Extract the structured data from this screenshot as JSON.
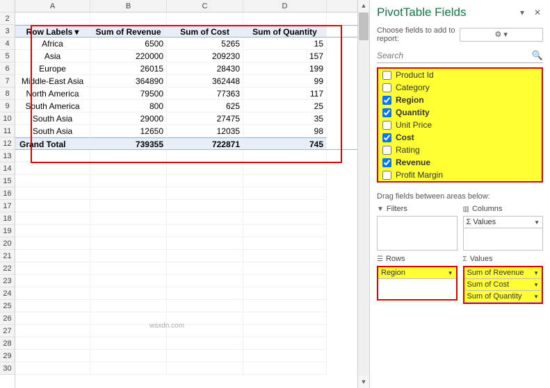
{
  "sheet": {
    "columns": [
      "A",
      "B",
      "C",
      "D"
    ],
    "row_start": 2,
    "row_end": 30,
    "pivot_headers": {
      "row_labels": "Row Labels",
      "sum_revenue": "Sum of Revenue",
      "sum_cost": "Sum of Cost",
      "sum_quantity": "Sum of Quantity"
    },
    "rows": [
      {
        "label": "Africa",
        "revenue": "6500",
        "cost": "5265",
        "quantity": "15"
      },
      {
        "label": "Asia",
        "revenue": "220000",
        "cost": "209230",
        "quantity": "157"
      },
      {
        "label": "Europe",
        "revenue": "26015",
        "cost": "28430",
        "quantity": "199"
      },
      {
        "label": "Middle-East Asia",
        "revenue": "364890",
        "cost": "362448",
        "quantity": "99"
      },
      {
        "label": "North America",
        "revenue": "79500",
        "cost": "77363",
        "quantity": "117"
      },
      {
        "label": "South America",
        "revenue": "800",
        "cost": "625",
        "quantity": "25"
      },
      {
        "label": "South Asia",
        "revenue": "29000",
        "cost": "27475",
        "quantity": "35"
      },
      {
        "label": "South Asia",
        "revenue": "12650",
        "cost": "12035",
        "quantity": "98"
      }
    ],
    "grand": {
      "label": "Grand Total",
      "revenue": "739355",
      "cost": "722871",
      "quantity": "745"
    }
  },
  "pane": {
    "title": "PivotTable Fields",
    "choose_label": "Choose fields to add to report:",
    "search_placeholder": "Search",
    "fields": [
      {
        "name": "Product Id",
        "checked": false
      },
      {
        "name": "Category",
        "checked": false
      },
      {
        "name": "Region",
        "checked": true
      },
      {
        "name": "Quantity",
        "checked": true
      },
      {
        "name": "Unit Price",
        "checked": false
      },
      {
        "name": "Cost",
        "checked": true
      },
      {
        "name": "Rating",
        "checked": false
      },
      {
        "name": "Revenue",
        "checked": true
      },
      {
        "name": "Profit Margin",
        "checked": false
      }
    ],
    "drag_label": "Drag fields between areas below:",
    "areas": {
      "filters": {
        "title": "Filters",
        "items": []
      },
      "columns": {
        "title": "Columns",
        "items": [
          "Σ Values"
        ]
      },
      "rows": {
        "title": "Rows",
        "items": [
          "Region"
        ]
      },
      "values": {
        "title": "Values",
        "items": [
          "Sum of Revenue",
          "Sum of Cost",
          "Sum of Quantity"
        ]
      }
    }
  },
  "watermark": "wsxdn.com"
}
